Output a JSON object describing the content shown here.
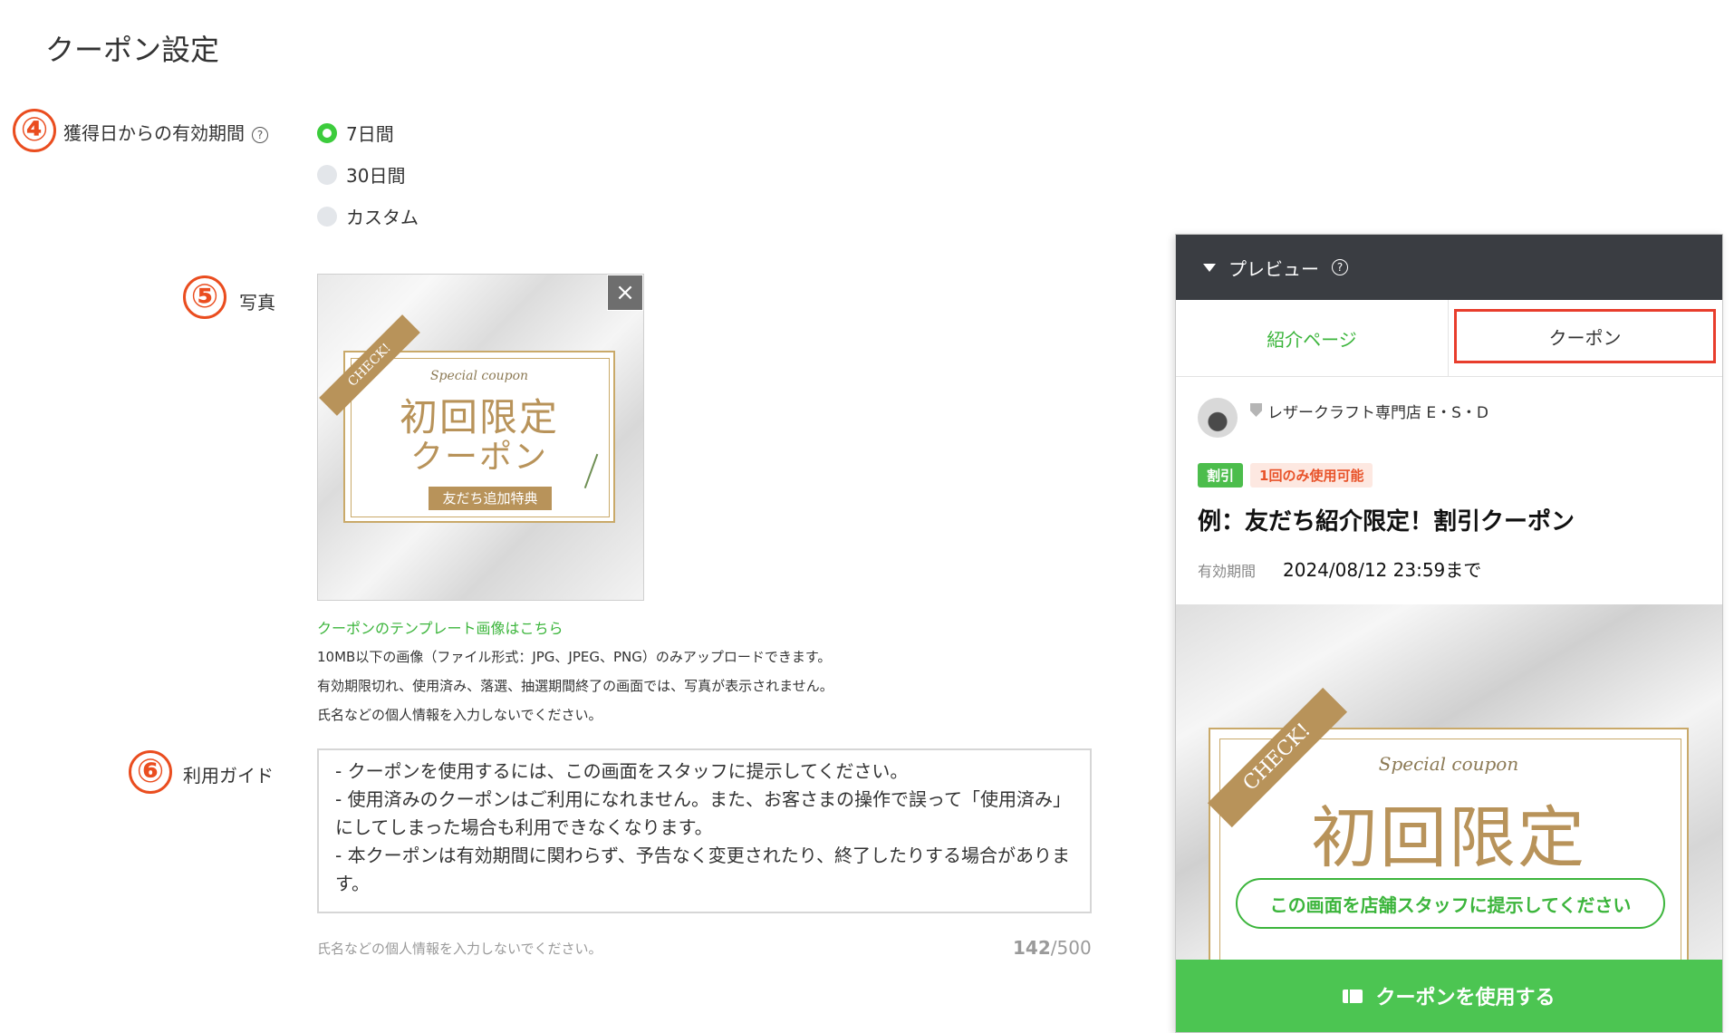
{
  "page": {
    "title": "クーポン設定"
  },
  "validity": {
    "step": "④",
    "label": "獲得日からの有効期間",
    "help": "?",
    "options": [
      {
        "label": "7日間",
        "selected": true
      },
      {
        "label": "30日間",
        "selected": false
      },
      {
        "label": "カスタム",
        "selected": false
      }
    ]
  },
  "photo": {
    "step": "⑤",
    "label": "写真",
    "close": "×",
    "template": {
      "ribbon": "CHECK!",
      "script": "Special coupon",
      "line1": "初回限定",
      "line2": "クーポン",
      "band": "友だち追加特典"
    },
    "template_link": "クーポンのテンプレート画像はこちら",
    "notes": [
      "10MB以下の画像（ファイル形式：JPG、JPEG、PNG）のみアップロードできます。",
      "有効期限切れ、使用済み、落選、抽選期間終了の画面では、写真が表示されません。",
      "氏名などの個人情報を入力しないでください。"
    ]
  },
  "guide": {
    "step": "⑥",
    "label": "利用ガイド",
    "text": "- クーポンを使用するには、この画面をスタッフに提示してください。\n- 使用済みのクーポンはご利用になれません。また、お客さまの操作で誤って「使用済み」にしてしまった場合も利用できなくなります。\n- 本クーポンは有効期間に関わらず、予告なく変更されたり、終了したりする場合があります。",
    "hint": "氏名などの個人情報を入力しないでください。",
    "count": "142",
    "max": "/500"
  },
  "preview": {
    "title": "プレビュー",
    "help": "?",
    "tabs": {
      "intro": "紹介ページ",
      "coupon": "クーポン"
    },
    "shop_name": "レザークラフト専門店 E・S・D",
    "badge_discount": "割引",
    "badge_once": "1回のみ使用可能",
    "coupon_title": "例：友だち紹介限定！割引クーポン",
    "validity_label": "有効期間",
    "validity_value": "2024/08/12 23:59まで",
    "img_ribbon": "CHECK!",
    "img_script": "Special coupon",
    "img_main": "初回限定",
    "bubble": "この画面を店舗スタッフに提示してください",
    "use_button": "クーポンを使用する"
  },
  "colors": {
    "accent_green": "#3cb53c",
    "step_orange": "#ea4d1f",
    "highlight_red": "#e83d2c"
  }
}
